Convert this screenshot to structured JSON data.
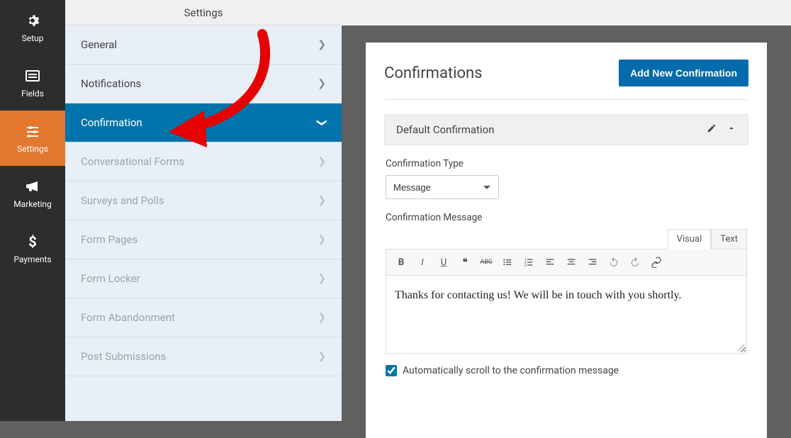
{
  "rail": {
    "items": [
      {
        "label": "Setup",
        "icon": "gear"
      },
      {
        "label": "Fields",
        "icon": "list"
      },
      {
        "label": "Settings",
        "icon": "sliders"
      },
      {
        "label": "Marketing",
        "icon": "bullhorn"
      },
      {
        "label": "Payments",
        "icon": "dollar"
      }
    ]
  },
  "subpanel": {
    "title": "Settings",
    "items": [
      {
        "label": "General",
        "active": false,
        "dim": false
      },
      {
        "label": "Notifications",
        "active": false,
        "dim": false
      },
      {
        "label": "Confirmation",
        "active": true,
        "dim": false
      },
      {
        "label": "Conversational Forms",
        "active": false,
        "dim": true
      },
      {
        "label": "Surveys and Polls",
        "active": false,
        "dim": true
      },
      {
        "label": "Form Pages",
        "active": false,
        "dim": true
      },
      {
        "label": "Form Locker",
        "active": false,
        "dim": true
      },
      {
        "label": "Form Abandonment",
        "active": false,
        "dim": true
      },
      {
        "label": "Post Submissions",
        "active": false,
        "dim": true
      }
    ]
  },
  "main": {
    "title": "Confirmations",
    "add_button": "Add New Confirmation",
    "accordion": {
      "title": "Default Confirmation",
      "type_label": "Confirmation Type",
      "type_value": "Message",
      "message_label": "Confirmation Message",
      "editor_tabs": {
        "visual": "Visual",
        "text": "Text"
      },
      "toolbar": [
        "bold",
        "italic",
        "underline",
        "quote",
        "strike",
        "ul",
        "ol",
        "align-left",
        "align-center",
        "align-right",
        "undo",
        "redo",
        "link"
      ],
      "message_value": "Thanks for contacting us! We will be in touch with you shortly.",
      "scroll_label": "Automatically scroll to the confirmation message",
      "scroll_checked": true
    }
  },
  "annotation": {
    "color": "#e60000"
  }
}
